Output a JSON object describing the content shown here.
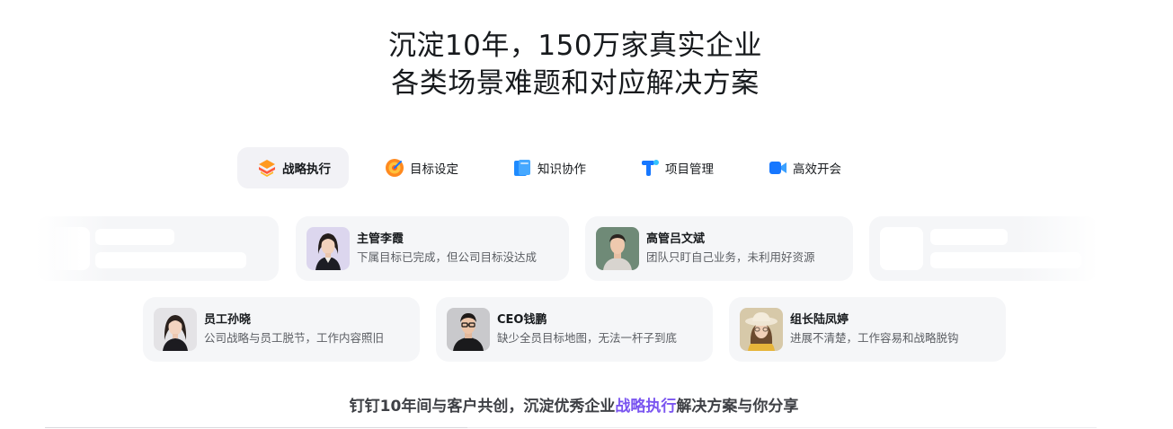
{
  "hero": {
    "line1": "沉淀10年，150万家真实企业",
    "line2": "各类场景难题和对应解决方案"
  },
  "tabs": [
    {
      "label": "战略执行",
      "icon": "strategy-icon",
      "active": true
    },
    {
      "label": "目标设定",
      "icon": "target-icon",
      "active": false
    },
    {
      "label": "知识协作",
      "icon": "knowledge-book-icon",
      "active": false
    },
    {
      "label": "项目管理",
      "icon": "project-t-icon",
      "active": false
    },
    {
      "label": "高效开会",
      "icon": "video-camera-icon",
      "active": false
    }
  ],
  "cards_row1": [
    {
      "name": "主管李霞",
      "desc": "下属目标已完成，但公司目标没达成",
      "avatar": "avatar-woman-black-blazer"
    },
    {
      "name": "高管吕文斌",
      "desc": "团队只盯自己业务，未利用好资源",
      "avatar": "avatar-man-gray-sweater"
    }
  ],
  "cards_row2": [
    {
      "name": "员工孙晓",
      "desc": "公司战略与员工脱节，工作内容照旧",
      "avatar": "avatar-woman-long-hair"
    },
    {
      "name": "CEO钱鹏",
      "desc": "缺少全员目标地图，无法一杆子到底",
      "avatar": "avatar-man-glasses"
    },
    {
      "name": "组长陆凤婷",
      "desc": "进展不清楚，工作容易和战略脱钩",
      "avatar": "avatar-woman-sun-hat"
    }
  ],
  "tagline": {
    "prefix": "钉钉10年间与客户共创，沉淀优秀企业",
    "highlight": "战略执行",
    "suffix": "解决方案与你分享"
  },
  "colors": {
    "accent": "#7a55f0",
    "card_bg": "#f5f6f8",
    "tab_active_bg": "#f2f2f6"
  }
}
